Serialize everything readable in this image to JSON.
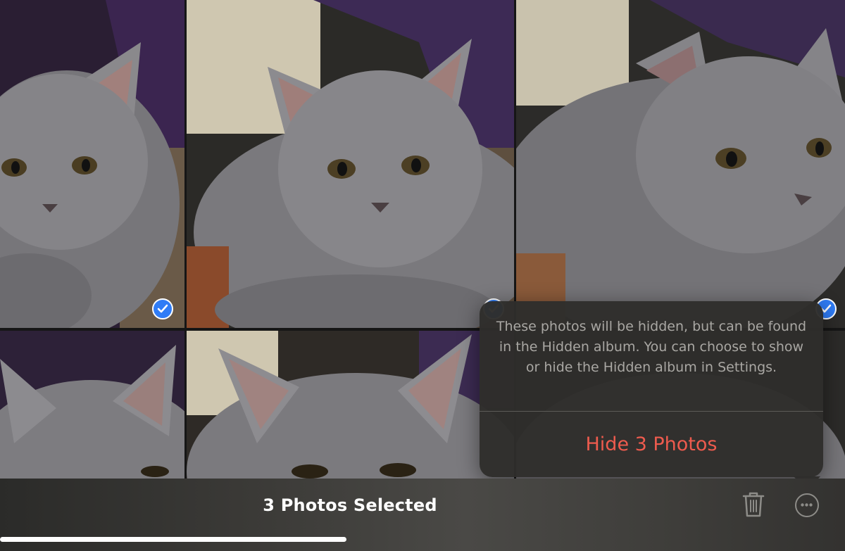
{
  "toolbar": {
    "title": "3 Photos Selected",
    "delete_icon": "trash-icon",
    "more_icon": "ellipsis-circle-icon"
  },
  "popover": {
    "message": "These photos will be hidden, but can be found in the Hidden album. You can choose to show or hide the Hidden album in Settings.",
    "action_label": "Hide 3 Photos",
    "action_color": "#ee5b4e"
  },
  "photos": [
    {
      "subject": "kitten",
      "selected": true
    },
    {
      "subject": "kitten",
      "selected": true
    },
    {
      "subject": "kitten",
      "selected": true
    },
    {
      "subject": "kitten",
      "selected": false
    },
    {
      "subject": "kitten",
      "selected": false
    },
    {
      "subject": "kitten",
      "selected": false
    }
  ],
  "colors": {
    "selection_blue": "#2f7cf6",
    "destructive_red": "#ee5b4e"
  }
}
